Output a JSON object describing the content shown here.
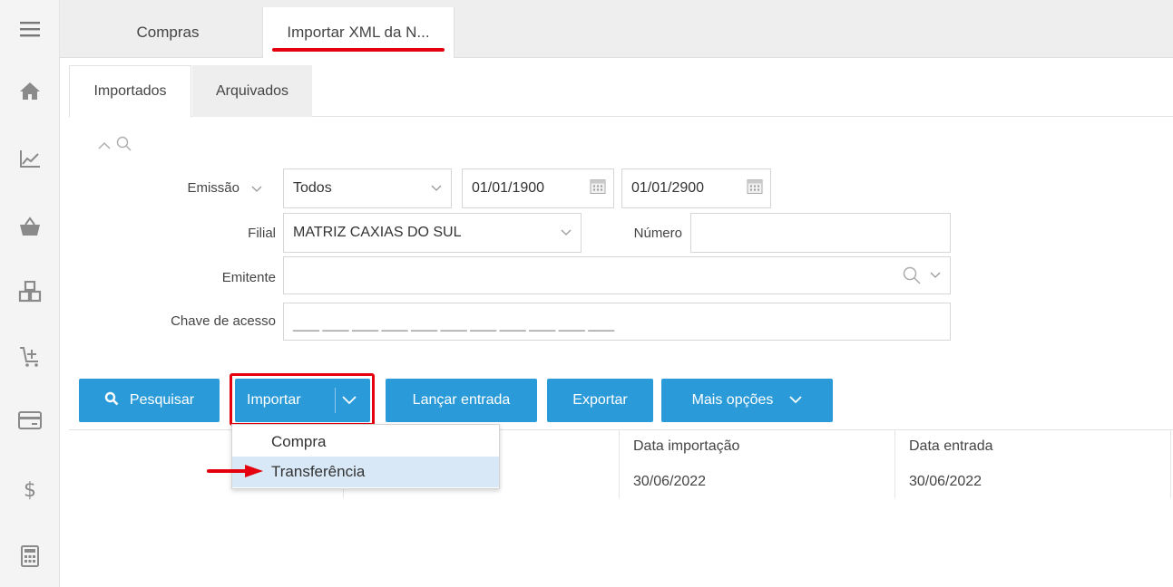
{
  "top_tabs": [
    {
      "label": "Compras"
    },
    {
      "label": "Importar XML da N..."
    }
  ],
  "inner_tabs": [
    {
      "label": "Importados"
    },
    {
      "label": "Arquivados"
    }
  ],
  "filters": {
    "emissao_label": "Emissão",
    "emissao_value": "Todos",
    "date_from": "01/01/1900",
    "date_to": "01/01/2900",
    "filial_label": "Filial",
    "filial_value": "MATRIZ CAXIAS DO SUL",
    "numero_label": "Número",
    "numero_value": "",
    "emitente_label": "Emitente",
    "emitente_value": "",
    "chave_label": "Chave de acesso",
    "chave_placeholder": "____ ____ ____ ____ ____ ____ ____ ____ ____ ____ ____"
  },
  "buttons": {
    "pesquisar": "Pesquisar",
    "importar": "Importar",
    "lancar": "Lançar entrada",
    "exportar": "Exportar",
    "mais": "Mais opções"
  },
  "importar_menu": {
    "items": [
      "Compra",
      "Transferência"
    ],
    "highlighted": "Transferência"
  },
  "table": {
    "columns": [
      "Data importação",
      "Data entrada"
    ],
    "rows": [
      {
        "data_importacao": "30/06/2022",
        "data_entrada": "30/06/2022"
      }
    ]
  },
  "colors": {
    "accent_blue": "#2a9bd8",
    "highlight_red": "#e4000f",
    "menu_hover": "#d8e8f6"
  },
  "icons": [
    "menu-icon",
    "home-icon",
    "chart-icon",
    "basket-icon",
    "boxes-icon",
    "cart-add-icon",
    "card-icon",
    "dollar-icon",
    "calculator-icon"
  ]
}
